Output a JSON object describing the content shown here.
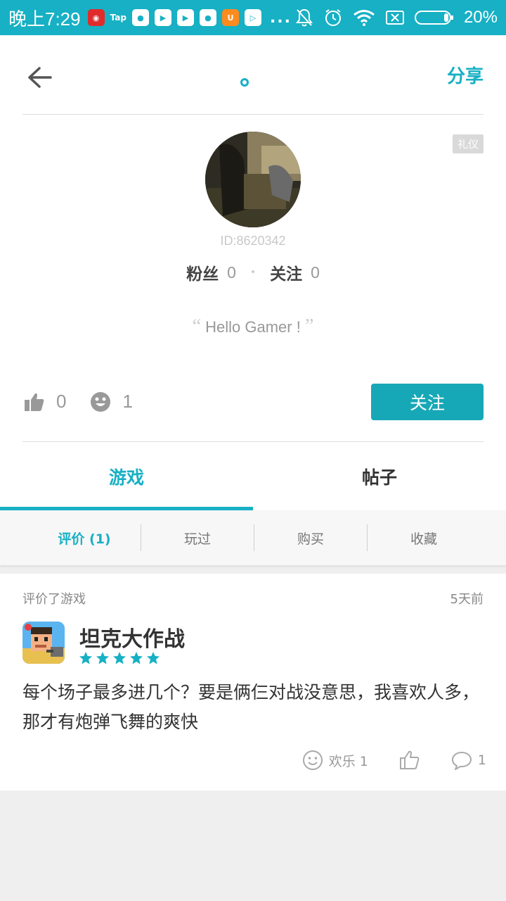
{
  "status_bar": {
    "time": "晚上7:29",
    "battery": "20%",
    "more": "..."
  },
  "header": {
    "share_label": "分享"
  },
  "profile": {
    "badge": "礼仪",
    "user_id": "ID:8620342",
    "fans_label": "粉丝",
    "fans_count": "0",
    "following_label": "关注",
    "following_count": "0",
    "bio_open_quote": "“",
    "bio": "Hello Gamer !",
    "bio_close_quote": "”",
    "likes_count": "0",
    "fun_count": "1",
    "follow_button": "关注"
  },
  "tabs": [
    {
      "label": "游戏",
      "active": true
    },
    {
      "label": "帖子",
      "active": false
    }
  ],
  "subtabs": [
    {
      "label": "评价 (1)",
      "active": true
    },
    {
      "label": "玩过",
      "active": false
    },
    {
      "label": "购买",
      "active": false
    },
    {
      "label": "收藏",
      "active": false
    }
  ],
  "review": {
    "action_text": "评价了游戏",
    "time": "5天前",
    "game_name": "坦克大作战",
    "rating_stars": 5,
    "text": "每个场子最多进几个？要是俩仨对战没意思，我喜欢人多，那才有炮弹飞舞的爽快",
    "fun_label": "欢乐 1",
    "comment_count": "1"
  },
  "colors": {
    "accent": "#17b0c4",
    "button": "#17a8b7",
    "status_bar": "#17b0c4"
  }
}
